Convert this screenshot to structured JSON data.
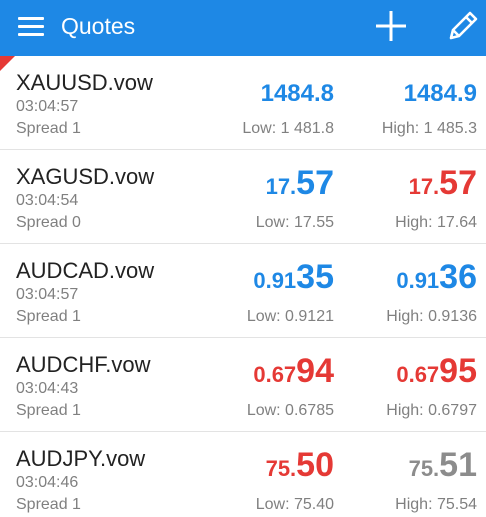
{
  "header": {
    "title": "Quotes"
  },
  "colors": {
    "up": "#1e88e5",
    "down": "#e53935",
    "neutral": "#8c8c8c",
    "header_bg": "#1e88e5"
  },
  "quotes": [
    {
      "symbol": "XAUUSD.vow",
      "time": "03:04:57",
      "spread": "Spread 1",
      "bid": {
        "full": "1484.8",
        "color": "up"
      },
      "ask": {
        "full": "1484.9",
        "color": "up"
      },
      "low": "Low: 1 481.8",
      "high": "High: 1 485.3"
    },
    {
      "symbol": "XAGUSD.vow",
      "time": "03:04:54",
      "spread": "Spread 0",
      "bid": {
        "small": "17.",
        "big": "57",
        "color": "up"
      },
      "ask": {
        "small": "17.",
        "big": "57",
        "color": "down"
      },
      "low": "Low: 17.55",
      "high": "High: 17.64"
    },
    {
      "symbol": "AUDCAD.vow",
      "time": "03:04:57",
      "spread": "Spread 1",
      "bid": {
        "small": "0.91",
        "big": "35",
        "color": "up"
      },
      "ask": {
        "small": "0.91",
        "big": "36",
        "color": "up"
      },
      "low": "Low: 0.9121",
      "high": "High: 0.9136"
    },
    {
      "symbol": "AUDCHF.vow",
      "time": "03:04:43",
      "spread": "Spread 1",
      "bid": {
        "small": "0.67",
        "big": "94",
        "color": "down"
      },
      "ask": {
        "small": "0.67",
        "big": "95",
        "color": "down"
      },
      "low": "Low: 0.6785",
      "high": "High: 0.6797"
    },
    {
      "symbol": "AUDJPY.vow",
      "time": "03:04:46",
      "spread": "Spread 1",
      "bid": {
        "small": "75.",
        "big": "50",
        "color": "down"
      },
      "ask": {
        "small": "75.",
        "big": "51",
        "color": "neutral"
      },
      "low": "Low: 75.40",
      "high": "High: 75.54"
    }
  ]
}
